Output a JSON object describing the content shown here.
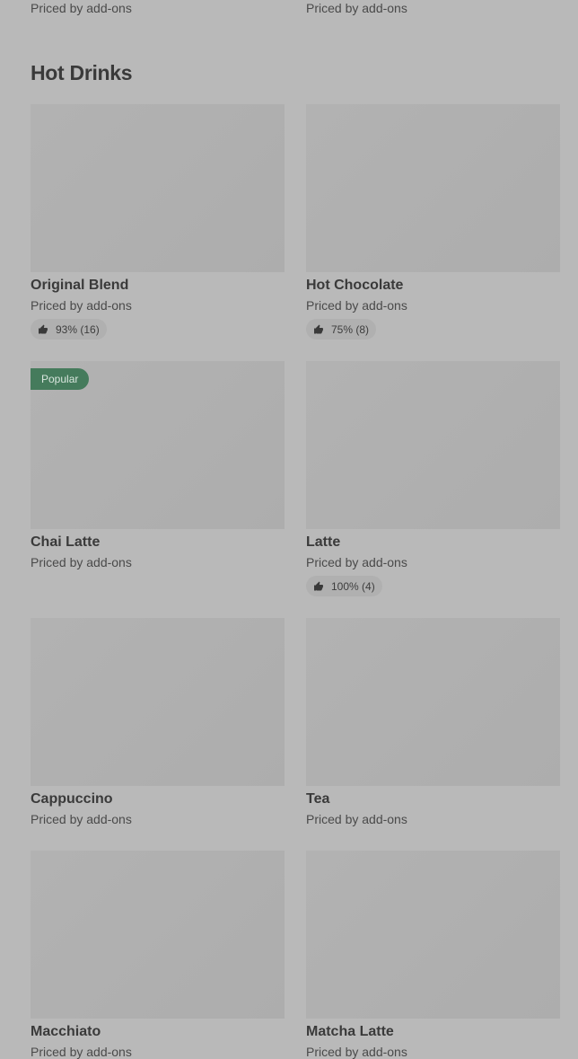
{
  "top_row": {
    "left_price": "Priced by add-ons",
    "right_price": "Priced by add-ons"
  },
  "section": {
    "title": "Hot Drinks"
  },
  "items": [
    {
      "name": "Original Blend",
      "price": "Priced by add-ons",
      "rating": "93% (16)",
      "badge": ""
    },
    {
      "name": "Hot Chocolate",
      "price": "Priced by add-ons",
      "rating": "75% (8)",
      "badge": ""
    },
    {
      "name": "Chai Latte",
      "price": "Priced by add-ons",
      "rating": "",
      "badge": "Popular"
    },
    {
      "name": "Latte",
      "price": "Priced by add-ons",
      "rating": "100% (4)",
      "badge": ""
    },
    {
      "name": "Cappuccino",
      "price": "Priced by add-ons",
      "rating": "",
      "badge": ""
    },
    {
      "name": "Tea",
      "price": "Priced by add-ons",
      "rating": "",
      "badge": ""
    },
    {
      "name": "Macchiato",
      "price": "Priced by add-ons",
      "rating": "",
      "badge": ""
    },
    {
      "name": "Matcha Latte",
      "price": "Priced by add-ons",
      "rating": "",
      "badge": ""
    }
  ],
  "icons": {
    "rating": "thumbs-up-icon"
  },
  "colors": {
    "background": "#b9b9b9",
    "image_placeholder": "#afafaf",
    "badge_bg": "#457b5c",
    "rating_pill_bg": "#b0b0b0"
  }
}
